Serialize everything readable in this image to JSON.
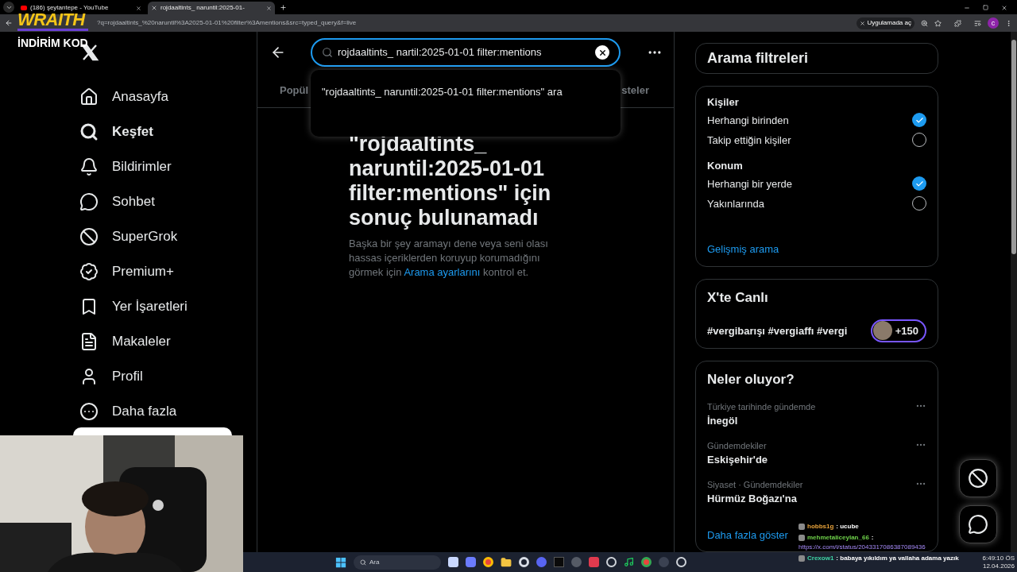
{
  "browser": {
    "tabs": [
      {
        "title": "(186) şeytantepe - YouTube",
        "kind": "video",
        "selected": false
      },
      {
        "title": "rojdaaltints_ naruntil:2025-01-",
        "kind": "x",
        "selected": true
      }
    ],
    "address": "?q=rojdaaltints_%20naruntil%3A2025-01-01%20filter%3Amentions&src=typed_query&f=live",
    "open_in_app": "Uygulamada aç",
    "profile_initial": "c"
  },
  "overlay": {
    "brand": "WRAITH",
    "promo": "İNDİRİM KOD"
  },
  "sidebar": {
    "items": [
      {
        "label": "Anasayfa",
        "kind": "home",
        "selected": false
      },
      {
        "label": "Keşfet",
        "kind": "search",
        "selected": true
      },
      {
        "label": "Bildirimler",
        "kind": "bell",
        "selected": false
      },
      {
        "label": "Sohbet",
        "kind": "chat",
        "selected": false
      },
      {
        "label": "SuperGrok",
        "kind": "grok",
        "selected": false
      },
      {
        "label": "Premium+",
        "kind": "premium",
        "selected": false
      },
      {
        "label": "Yer İşaretleri",
        "kind": "bookmark",
        "selected": false
      },
      {
        "label": "Makaleler",
        "kind": "article",
        "selected": false
      },
      {
        "label": "Profil",
        "kind": "profile",
        "selected": false
      },
      {
        "label": "Daha fazla",
        "kind": "more",
        "selected": false
      }
    ]
  },
  "search": {
    "value": "rojdaaltints_ nartil:2025-01-01 filter:mentions",
    "suggestion": "\"rojdaaltints_ naruntil:2025-01-01 filter:mentions\" ara"
  },
  "tabs": [
    {
      "label": "Popül",
      "selected": false
    },
    {
      "label": "steler",
      "selected": false
    }
  ],
  "empty": {
    "heading": "\"rojdaaltints_ naruntil:2025-01-01 filter:mentions\" için sonuç bulunamadı",
    "body": "Başka bir şey aramayı dene veya seni olası hassas içeriklerden koruyup korumadığını görmek için",
    "link": "Arama ayarlarını",
    "body_end": "kontrol et."
  },
  "filters": {
    "title": "Arama filtreleri",
    "groups": [
      {
        "label": "Kişiler",
        "options": [
          {
            "label": "Herhangi birinden",
            "selected": true
          },
          {
            "label": "Takip ettiğin kişiler",
            "selected": false
          }
        ]
      },
      {
        "label": "Konum",
        "options": [
          {
            "label": "Herhangi bir yerde",
            "selected": true
          },
          {
            "label": "Yakınlarında",
            "selected": false
          }
        ]
      }
    ],
    "advanced": "Gelişmiş arama"
  },
  "live": {
    "title": "X'te Canlı",
    "topic": "#vergibarışı #vergiaffı #vergi",
    "count": "+150"
  },
  "trends": {
    "title": "Neler oluyor?",
    "items": [
      {
        "context": "Türkiye tarihinde gündemde",
        "name": "İnegöl"
      },
      {
        "context": "Gündemdekiler",
        "name": "Eskişehir'de"
      },
      {
        "context": "Siyaset · Gündemdekiler",
        "name": "Hürmüz Boğazı'na"
      }
    ],
    "more": "Daha fazla göster"
  },
  "chat": [
    {
      "user": "hobbs1g",
      "color": "#e8a23a",
      "text": ": ucube"
    },
    {
      "user": "mehmetaliceylan_66",
      "color": "#6fd24a",
      "text": ":",
      "link": "https://x.com/i/status/2043317086387089436"
    },
    {
      "user": "Crexow1",
      "color": "#3fd6a6",
      "text": ": babaya yıkıldım ya vallaha adama yazık"
    }
  ],
  "taskbar": {
    "search_placeholder": "Ara",
    "time": "6:49:10 ÖS",
    "date": "12.04.2026"
  }
}
